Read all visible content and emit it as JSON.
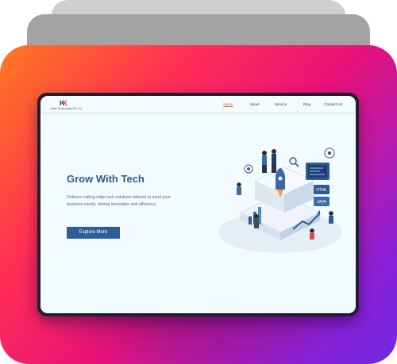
{
  "brand": {
    "logo_letter": "K",
    "logo_text": "Keltec Technologies Pvt. Ltd"
  },
  "nav": {
    "items": [
      "Home",
      "About",
      "Service",
      "Blog",
      "Contact Us"
    ],
    "active": "Home"
  },
  "hero": {
    "title": "Grow With Tech",
    "description": "Delivers cutting-edge tech solutions tailored to meet your business needs, driving innovation and efficiency.",
    "cta": "Explore More"
  },
  "illustration": {
    "screen_labels": [
      "HTML",
      "JAVA"
    ]
  },
  "colors": {
    "primary": "#305c9c",
    "title": "#2f5a92",
    "accent_active": "#e0553d",
    "background": "#f2fbfd",
    "frame_gradient": [
      "#ff7a1f",
      "#ff2d55",
      "#e8127a",
      "#8a20d6",
      "#6f2ae0"
    ]
  }
}
